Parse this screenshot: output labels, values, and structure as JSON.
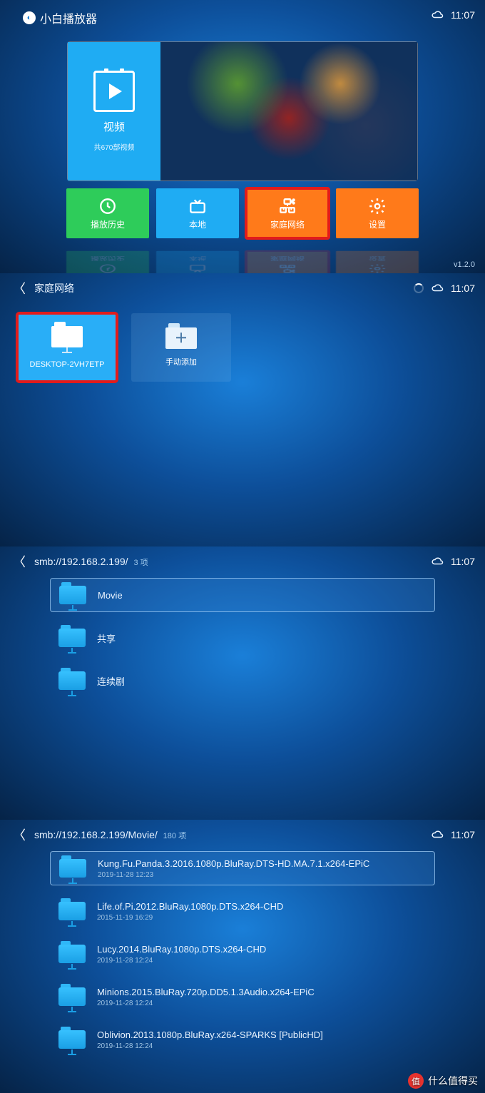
{
  "screen1": {
    "app_name": "小白播放器",
    "time": "11:07",
    "hero": {
      "title": "视频",
      "subtitle": "共670部视频"
    },
    "tiles": [
      {
        "label": "播放历史",
        "color": "t-green",
        "icon": "clock-icon"
      },
      {
        "label": "本地",
        "color": "t-blue",
        "icon": "tv-icon"
      },
      {
        "label": "家庭网络",
        "color": "t-orange",
        "icon": "network-icon",
        "highlight": true
      },
      {
        "label": "设置",
        "color": "t-orange",
        "icon": "gear-icon"
      }
    ],
    "version": "v1.2.0"
  },
  "screen2": {
    "crumb": "家庭网络",
    "time": "11:07",
    "tiles": [
      {
        "label": "DESKTOP-2VH7ETP",
        "selected": true,
        "type": "folder"
      },
      {
        "label": "手动添加",
        "selected": false,
        "type": "add"
      }
    ]
  },
  "screen3": {
    "path": "smb://192.168.2.199/",
    "count": "3 项",
    "time": "11:07",
    "rows": [
      {
        "name": "Movie",
        "selected": true
      },
      {
        "name": "共享",
        "selected": false
      },
      {
        "name": "连续剧",
        "selected": false
      }
    ]
  },
  "screen4": {
    "path": "smb://192.168.2.199/Movie/",
    "count": "180 项",
    "time": "11:07",
    "rows": [
      {
        "name": "Kung.Fu.Panda.3.2016.1080p.BluRay.DTS-HD.MA.7.1.x264-EPiC",
        "meta": "2019-11-28 12:23",
        "selected": true
      },
      {
        "name": "Life.of.Pi.2012.BluRay.1080p.DTS.x264-CHD",
        "meta": "2015-11-19 16:29"
      },
      {
        "name": "Lucy.2014.BluRay.1080p.DTS.x264-CHD",
        "meta": "2019-11-28 12:24"
      },
      {
        "name": "Minions.2015.BluRay.720p.DD5.1.3Audio.x264-EPiC",
        "meta": "2019-11-28 12:24"
      },
      {
        "name": "Oblivion.2013.1080p.BluRay.x264-SPARKS [PublicHD]",
        "meta": "2019-11-28 12:24"
      }
    ],
    "watermark": "什么值得买"
  }
}
